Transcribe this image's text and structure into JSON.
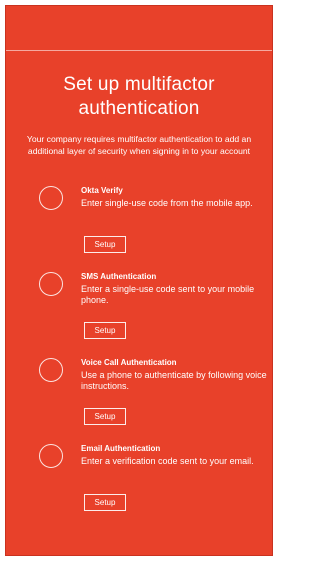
{
  "page": {
    "title": "Set up multifactor authentication",
    "subtitle": "Your company requires multifactor authentication to add an additional layer of security when signing in to your account"
  },
  "factors": [
    {
      "name": "Okta Verify",
      "description": "Enter single-use code from the mobile app.",
      "button_label": "Setup"
    },
    {
      "name": "SMS Authentication",
      "description": "Enter a single-use code sent to your mobile phone.",
      "button_label": "Setup"
    },
    {
      "name": "Voice Call Authentication",
      "description": "Use a phone to authenticate by following voice instructions.",
      "button_label": "Setup"
    },
    {
      "name": "Email Authentication",
      "description": "Enter a verification code sent to your email.",
      "button_label": "Setup"
    }
  ],
  "colors": {
    "background": "#e8412a",
    "text": "#ffffff"
  }
}
